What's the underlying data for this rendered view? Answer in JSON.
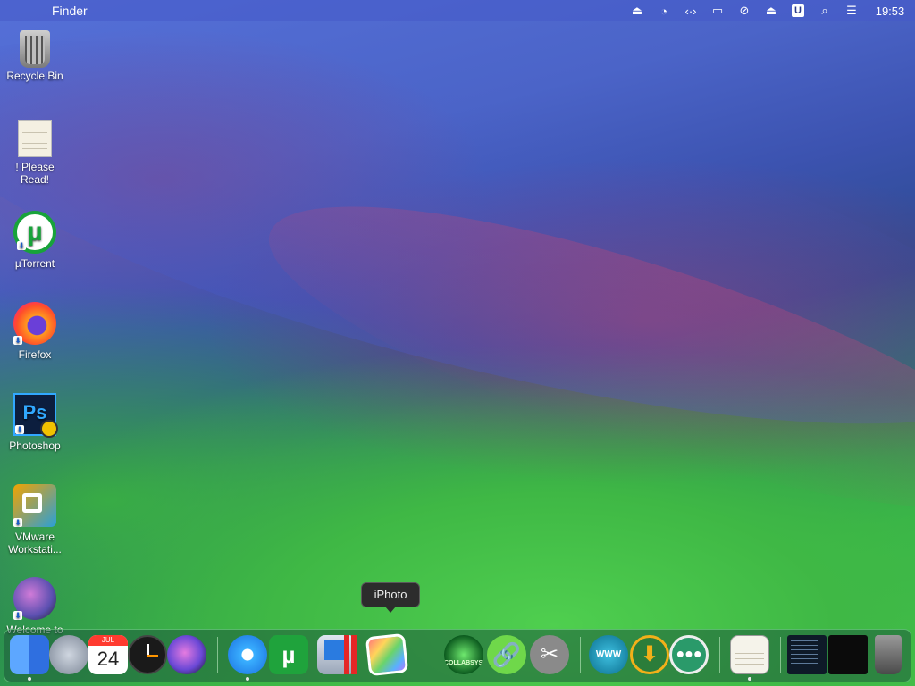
{
  "menubar": {
    "apple_glyph": "",
    "app_name": "Finder",
    "clock": "19:53",
    "tray_icons": [
      "eject-circle-icon",
      "timer-icon",
      "code-arrows-icon",
      "display-icon",
      "mute-icon",
      "eject-icon",
      "u-icon",
      "search-icon",
      "control-center-icon"
    ],
    "u_label": "U"
  },
  "desktop": {
    "icons": [
      {
        "name": "recycle-bin",
        "label": "Recycle Bin"
      },
      {
        "name": "please-read",
        "label": "! Please Read!"
      },
      {
        "name": "utorrent",
        "label": "µTorrent"
      },
      {
        "name": "firefox",
        "label": "Firefox"
      },
      {
        "name": "photoshop",
        "label": "Photoshop"
      },
      {
        "name": "vmware",
        "label": "VMware Workstati..."
      },
      {
        "name": "welcome",
        "label": "Welcome to"
      }
    ]
  },
  "dock": {
    "tooltip": "iPhoto",
    "calendar_month": "JUL",
    "calendar_day": "24",
    "collab_label": "COLLABSYSOS",
    "utor_glyph": "µ",
    "ps_label": "Ps",
    "www_label": "WWW",
    "link_glyph": "🔗",
    "tools_glyph": "✂",
    "download_glyph": "⬇",
    "drops_glyph": "●●●",
    "shortcut_glyph": "⬇"
  }
}
